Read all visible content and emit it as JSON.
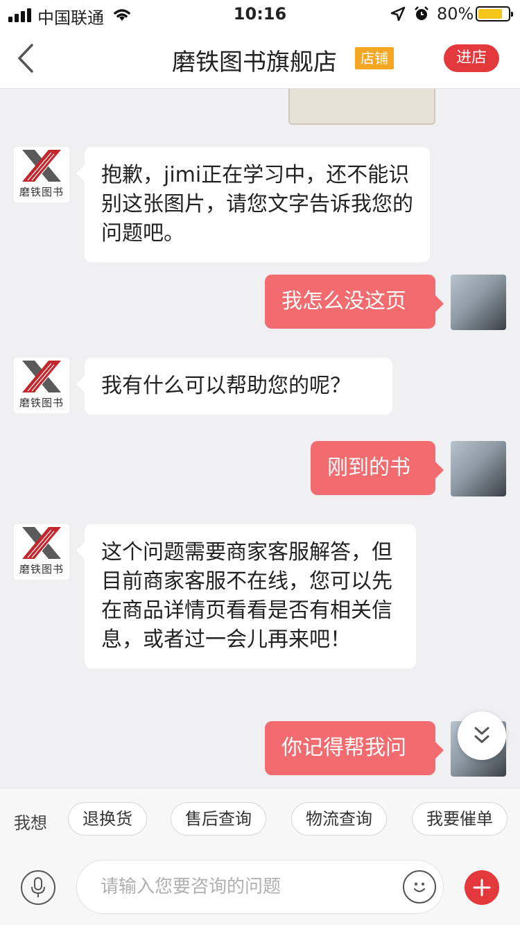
{
  "status_bar": {
    "carrier": "中国联通",
    "time": "10:16",
    "battery": "80%",
    "battery_level": 0.8,
    "icons": [
      "signal-icon",
      "wifi-icon",
      "location-icon",
      "alarm-icon",
      "battery-icon"
    ]
  },
  "header": {
    "title": "磨铁图书旗舰店",
    "badge": "店铺",
    "enter_label": "进店",
    "accent": "#e4393c",
    "badge_color": "#f5a623"
  },
  "shop": {
    "brand_text": "磨铁图书"
  },
  "messages": [
    {
      "from": "shop",
      "text": "抱歉，jimi正在学习中，还不能识别这张图片，请您文字告诉我您的问题吧。"
    },
    {
      "from": "user",
      "text": "我怎么没这页"
    },
    {
      "from": "shop",
      "text": "我有什么可以帮助您的呢？"
    },
    {
      "from": "user",
      "text": "刚到的书"
    },
    {
      "from": "shop",
      "text": "这个问题需要商家客服解答，但目前商家客服不在线，您可以先在商品详情页看看是否有相关信息，或者过一会儿再来吧！"
    },
    {
      "from": "user",
      "text": "你记得帮我问"
    }
  ],
  "quick_replies": {
    "label": "我想",
    "options": [
      "退换货",
      "售后查询",
      "物流查询",
      "我要催单"
    ]
  },
  "input": {
    "placeholder": "请输入您要咨询的问题",
    "value": ""
  },
  "colors": {
    "user_bubble": "#f26b6e",
    "shop_bubble": "#ffffff",
    "background": "#f0f0f2"
  }
}
